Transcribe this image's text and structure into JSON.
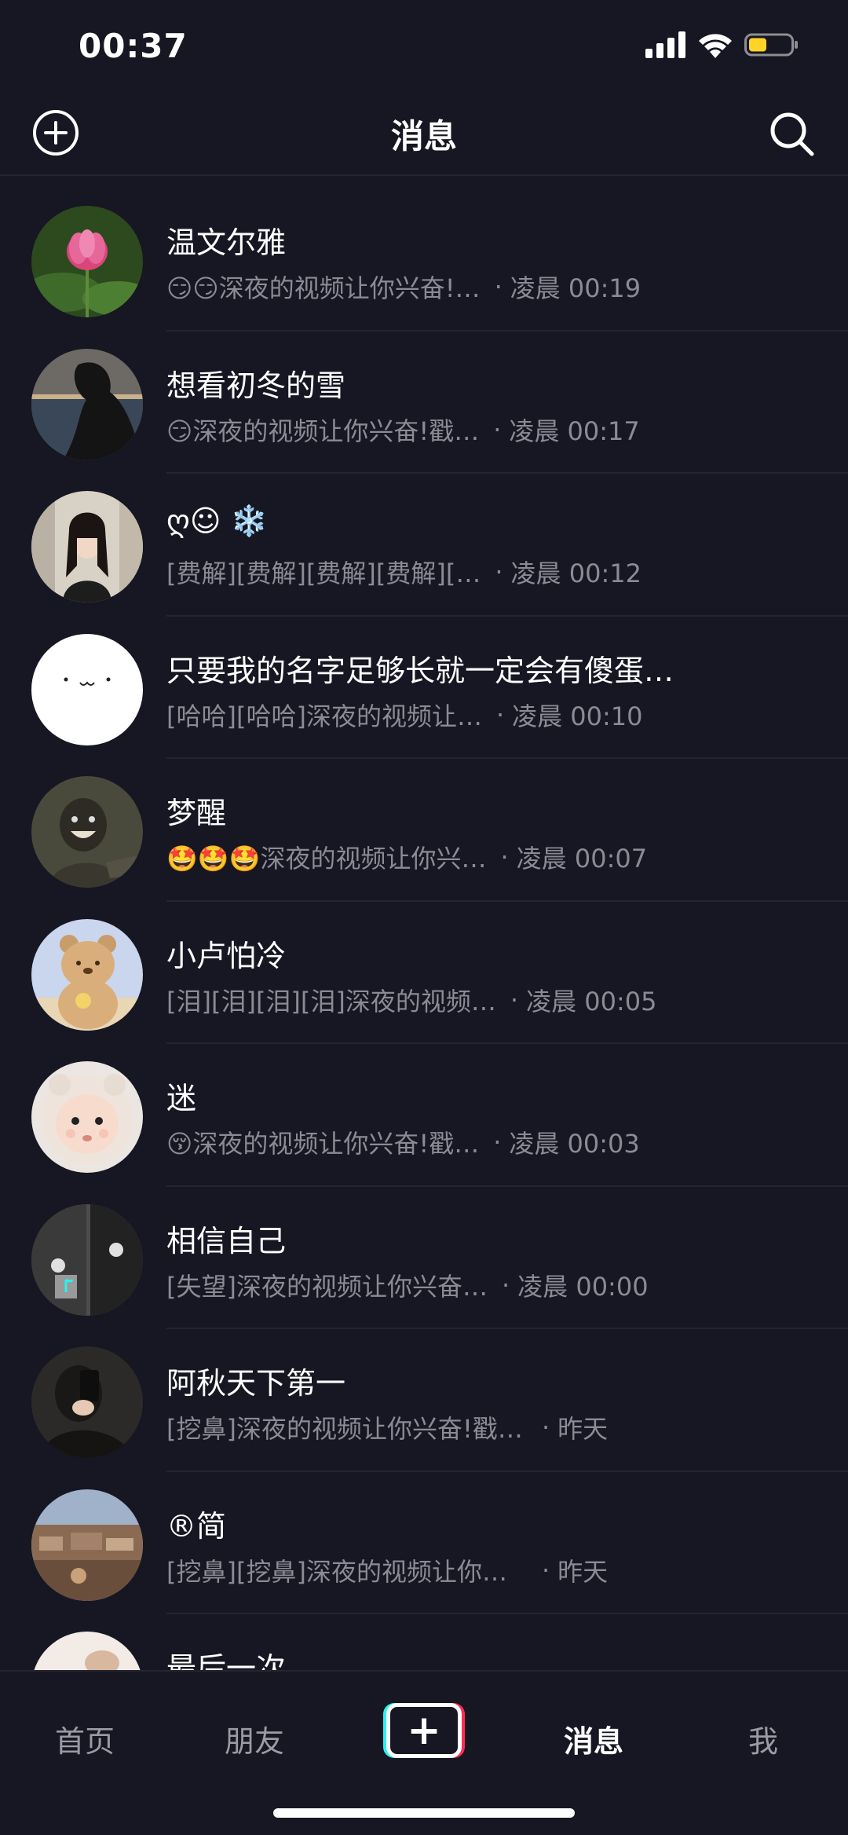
{
  "status_bar": {
    "time": "00:37",
    "icons": [
      "cellular-signal-icon",
      "wifi-icon",
      "battery-icon"
    ]
  },
  "header": {
    "title": "消息",
    "add_icon": "plus-circle-icon",
    "search_icon": "search-icon"
  },
  "messages": [
    {
      "name": "温文尔雅",
      "preview": "😏😏深夜的视频让你兴奋!…",
      "time": "凌晨 00:19",
      "avatar": "lotus"
    },
    {
      "name": "想看初冬的雪",
      "preview": "😏深夜的视频让你兴奋!戳…",
      "time": "凌晨 00:17",
      "avatar": "silhouette"
    },
    {
      "name": "ღ☺︎ ❄️",
      "preview": "[费解][费解][费解][费解][…",
      "time": "凌晨 00:12",
      "avatar": "girl"
    },
    {
      "name": "只要我的名字足够长就一定会有傻蛋…",
      "preview": "[哈哈][哈哈]深夜的视频让…",
      "time": "凌晨 00:10",
      "avatar": "blank-face"
    },
    {
      "name": "梦醒",
      "preview": "🤩🤩🤩深夜的视频让你兴…",
      "time": "凌晨 00:07",
      "avatar": "kid"
    },
    {
      "name": "小卢怕冷",
      "preview": "[泪][泪][泪][泪]深夜的视频…",
      "time": "凌晨 00:05",
      "avatar": "bear"
    },
    {
      "name": "迷",
      "preview": "😚深夜的视频让你兴奋!戳…",
      "time": "凌晨 00:03",
      "avatar": "baby"
    },
    {
      "name": "相信自己",
      "preview": "[失望]深夜的视频让你兴奋…",
      "time": "凌晨 00:00",
      "avatar": "hands"
    },
    {
      "name": "阿秋天下第一",
      "preview": "[挖鼻]深夜的视频让你兴奋!戳 htt…",
      "time": "昨天",
      "avatar": "selfie"
    },
    {
      "name": "®简",
      "preview": "[挖鼻][挖鼻]深夜的视频让你兴奋!…",
      "time": "昨天",
      "avatar": "city"
    },
    {
      "name": "最后一次",
      "preview": "",
      "time": "",
      "avatar": "partial"
    }
  ],
  "separator_dot": "·",
  "tab_bar": {
    "home": "首页",
    "friends": "朋友",
    "create": "+",
    "messages": "消息",
    "me": "我",
    "active": "messages"
  },
  "colors": {
    "background": "#161722",
    "preview_text": "#8a8b94",
    "accent_cyan": "#25f4ee",
    "accent_red": "#fe2c55"
  }
}
